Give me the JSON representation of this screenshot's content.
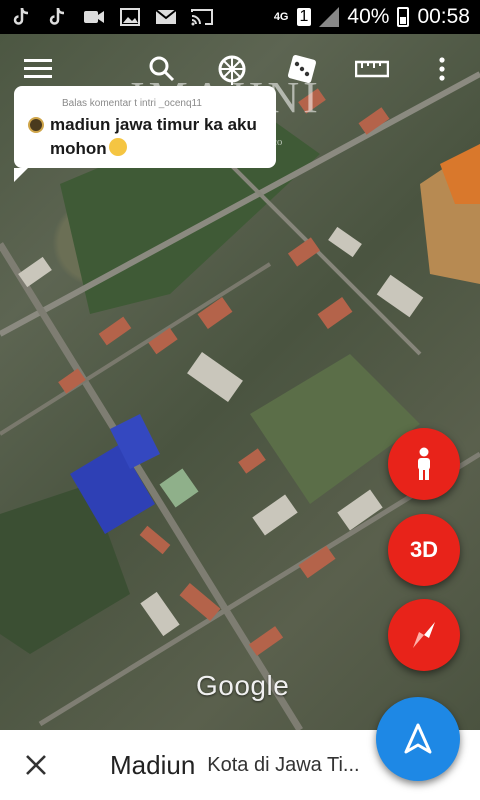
{
  "status_bar": {
    "network": "4G",
    "sim_slot": "1",
    "battery": "40%",
    "time": "00:58",
    "icons": [
      "tiktok-icon",
      "tiktok-icon",
      "video-camera-icon",
      "image-icon",
      "mail-icon",
      "cast-icon"
    ]
  },
  "toolbar": {
    "icons": [
      "menu-icon",
      "search-icon",
      "steering-wheel-icon",
      "dice-icon",
      "ruler-icon",
      "more-vert-icon"
    ]
  },
  "watermark": {
    "text": "IMAJINI",
    "sub": "co"
  },
  "comment": {
    "reply_label": "Balas komentar t intri _ocenq11",
    "text": "madiun jawa timur ka aku mohon"
  },
  "fabs": {
    "person": "person-icon",
    "three_d_label": "3D",
    "compass": "compass-icon",
    "navigate": "navigation-arrow-icon"
  },
  "map": {
    "attribution": "Google"
  },
  "place": {
    "name": "Madiun",
    "description": "Kota di Jawa Ti..."
  },
  "colors": {
    "fab_red": "#e8231a",
    "fab_blue": "#1e88e5",
    "bottom_bar": "#ffffff"
  }
}
